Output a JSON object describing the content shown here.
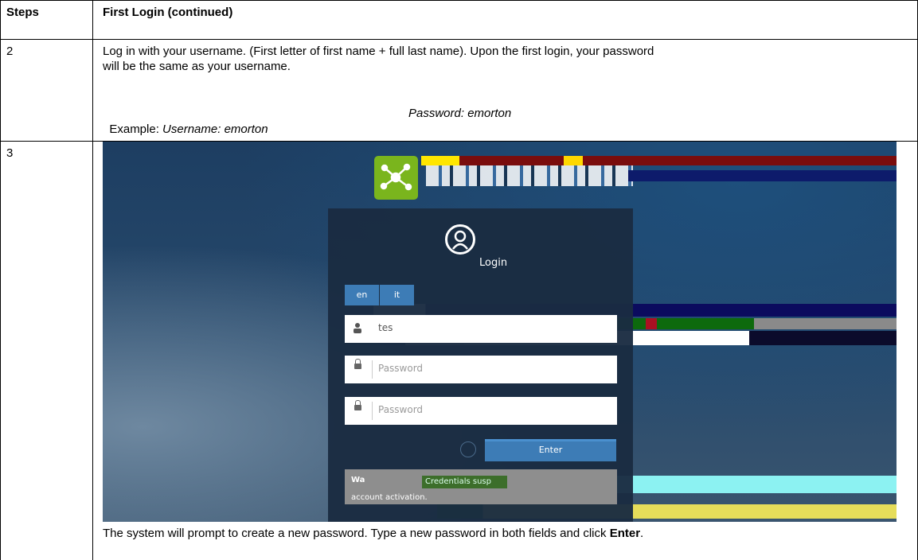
{
  "header": {
    "steps_label": "Steps",
    "section_title": "First Login (continued)"
  },
  "rows": [
    {
      "step": "2",
      "text_line1": "Log in with your username. (First letter of first name + full last name). Upon the first login, your password",
      "text_line2": "will be the same as your username.",
      "example_prefix": "Example: ",
      "example_username": "Username: emorton",
      "example_password": "Password: emorton"
    },
    {
      "step": "3",
      "caption_before": "The system will prompt to create a new password. Type a new password in both fields and click ",
      "caption_bold": "Enter",
      "caption_after": "."
    }
  ],
  "screenshot": {
    "login_title": "Login",
    "languages": [
      "en",
      "it"
    ],
    "username_partial": "tes",
    "password_placeholder": "Password",
    "confirm_placeholder": "Password",
    "enter_label": "Enter",
    "warning_prefix": "Wa",
    "warning_credentials": "Credentials susp",
    "warning_text": "account activation.",
    "icons": [
      "network-logo-icon",
      "user-circle-icon",
      "user-icon",
      "lock-icon"
    ],
    "colors": {
      "accent": "#3d7cb6",
      "logo": "#7ab51d",
      "panel": "#1a2c42"
    }
  }
}
